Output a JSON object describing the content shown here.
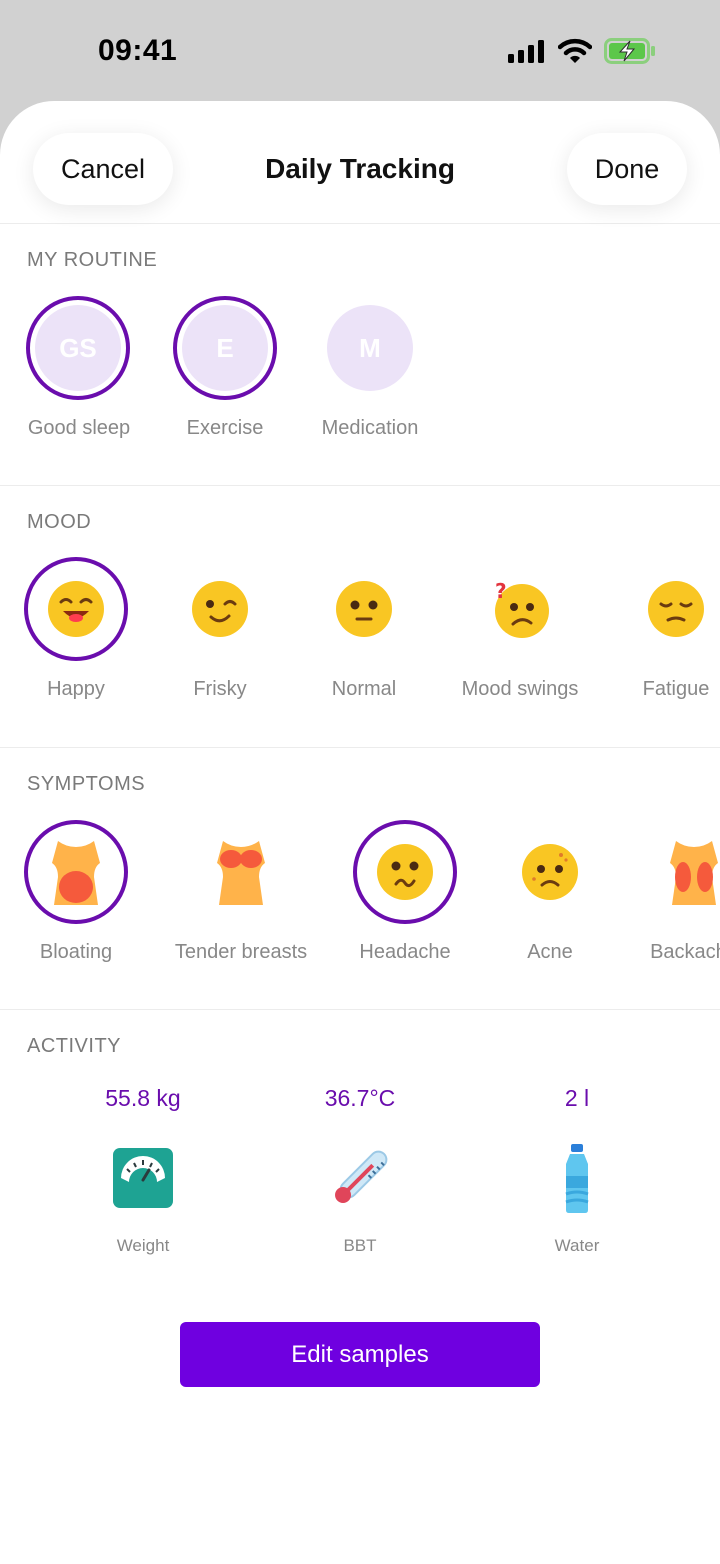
{
  "status_bar": {
    "time": "09:41"
  },
  "nav": {
    "cancel_label": "Cancel",
    "title": "Daily Tracking",
    "done_label": "Done"
  },
  "routine": {
    "title": "MY ROUTINE",
    "items": [
      {
        "initials": "GS",
        "label": "Good sleep",
        "selected": true
      },
      {
        "initials": "E",
        "label": "Exercise",
        "selected": true
      },
      {
        "initials": "M",
        "label": "Medication",
        "selected": false
      }
    ]
  },
  "mood": {
    "title": "MOOD",
    "items": [
      {
        "label": "Happy",
        "icon": "happy-face-icon",
        "selected": true
      },
      {
        "label": "Frisky",
        "icon": "winking-face-icon",
        "selected": false
      },
      {
        "label": "Normal",
        "icon": "neutral-face-icon",
        "selected": false
      },
      {
        "label": "Mood swings",
        "icon": "confused-face-icon",
        "selected": false
      },
      {
        "label": "Fatigue",
        "icon": "tired-face-icon",
        "selected": false
      }
    ]
  },
  "symptoms": {
    "title": "SYMPTOMS",
    "items": [
      {
        "label": "Bloating",
        "icon": "bloating-body-icon",
        "selected": true
      },
      {
        "label": "Tender breasts",
        "icon": "tender-breasts-body-icon",
        "selected": false
      },
      {
        "label": "Headache",
        "icon": "headache-face-icon",
        "selected": true
      },
      {
        "label": "Acne",
        "icon": "acne-face-icon",
        "selected": false
      },
      {
        "label": "Backache",
        "icon": "backache-body-icon",
        "selected": false
      }
    ]
  },
  "activity": {
    "title": "ACTIVITY",
    "items": [
      {
        "value": "55.8 kg",
        "label": "Weight",
        "icon": "scale-icon"
      },
      {
        "value": "36.7°C",
        "label": "BBT",
        "icon": "thermometer-icon"
      },
      {
        "value": "2 l",
        "label": "Water",
        "icon": "water-bottle-icon"
      }
    ]
  },
  "edit_button_label": "Edit samples",
  "colors": {
    "accent": "#6f00e0",
    "ring": "#6a0dad",
    "routine_bg": "#ece3f8",
    "emoji": "#f9c623"
  }
}
